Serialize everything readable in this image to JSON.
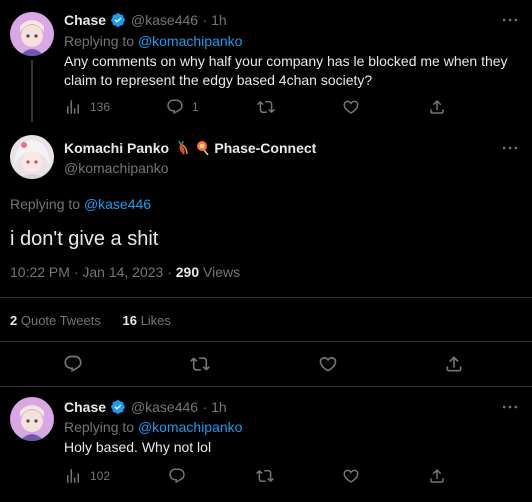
{
  "reply1": {
    "name": "Chase",
    "handle": "@kase446",
    "time": "· 1h",
    "replying_prefix": "Replying to",
    "replying_to": "@komachipanko",
    "text_line1": "Any comments on why half your company has le blocked me when they",
    "text_line2": "claim to represent the edgy based 4chan society?",
    "views": "136",
    "replies": "1"
  },
  "main": {
    "name": "Komachi Panko",
    "name_suffix": "Phase-Connect",
    "handle": "@komachipanko",
    "replying_prefix": "Replying to",
    "replying_to": "@kase446",
    "text": "i don't give a shit",
    "timestamp": "10:22 PM · Jan 14, 2023 · ",
    "views_count": "290",
    "views_label": " Views",
    "quote_count": "2",
    "quote_label": "Quote Tweets",
    "likes_count": "16",
    "likes_label": "Likes"
  },
  "reply2": {
    "name": "Chase",
    "handle": "@kase446",
    "time": "· 1h",
    "replying_prefix": "Replying to",
    "replying_to": "@komachipanko",
    "text": "Holy based. Why not lol",
    "views": "102"
  },
  "colors": {
    "background": "#000000",
    "text": "#e7e9ea",
    "muted": "#71767b",
    "accent": "#1d9bf0",
    "divider": "#2f3336"
  },
  "icons": [
    "verified-badge-icon",
    "views-icon",
    "reply-icon",
    "retweet-icon",
    "like-icon",
    "share-icon",
    "more-icon"
  ]
}
